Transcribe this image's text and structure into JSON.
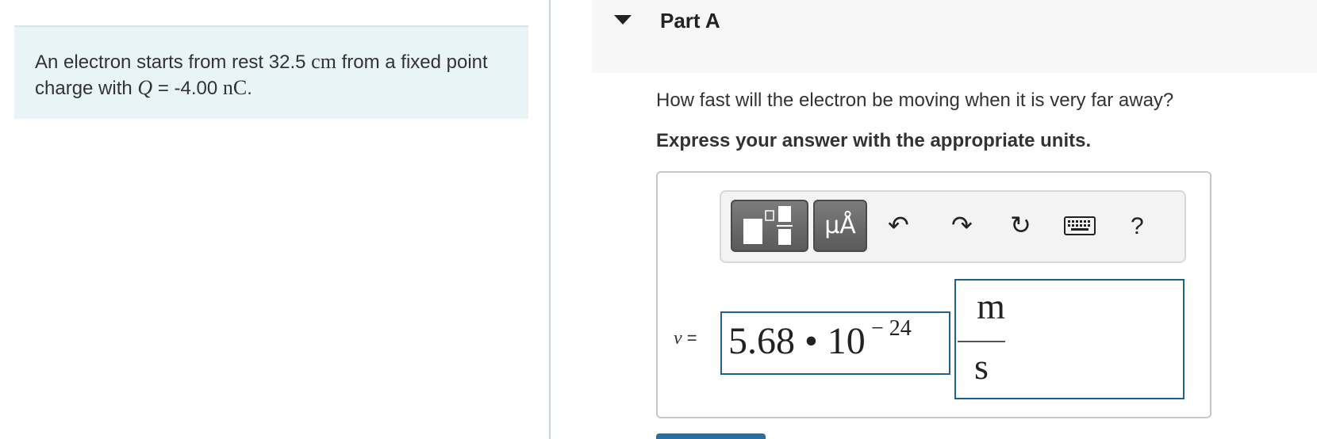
{
  "problem": {
    "text_1": "An electron starts from rest 32.5",
    "unit_cm": "cm",
    "text_2": "from a fixed point charge with",
    "var_Q": "Q",
    "text_3": "= -4.00",
    "unit_nC": "nC",
    "text_end": "."
  },
  "part": {
    "title": "Part A",
    "question": "How fast will the electron be moving when it is very far away?",
    "instruction": "Express your answer with the appropriate units."
  },
  "toolbar": {
    "units_label": "μÅ",
    "undo_icon": "↶",
    "redo_icon": "↷",
    "reset_icon": "↻",
    "help_label": "?"
  },
  "answer": {
    "variable": "v",
    "equals": "=",
    "value": "5.68 • 10",
    "exponent": "− 24",
    "unit_numerator": "m",
    "unit_denominator": "s"
  },
  "colors": {
    "problem_bg": "#e9f4f7",
    "field_border": "#1f6190",
    "toolbar_button": "#6a6a6a",
    "submit": "#2a6fa0"
  }
}
